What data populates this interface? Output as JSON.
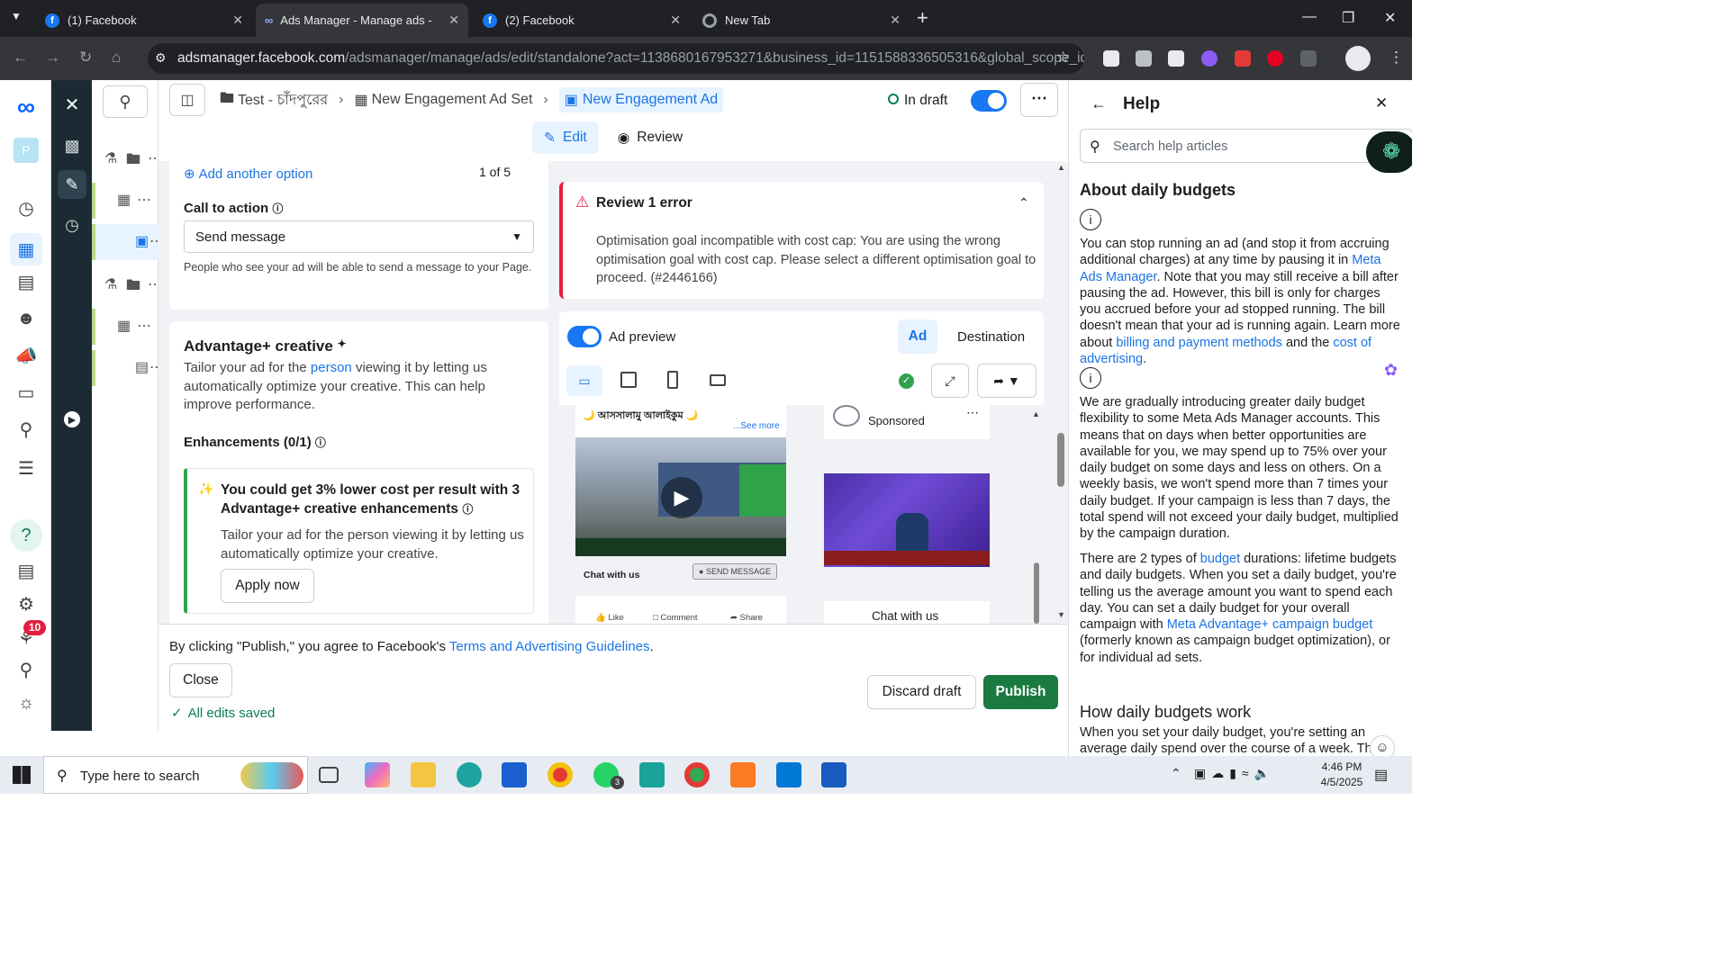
{
  "browser": {
    "tabs": [
      {
        "title": "(1) Facebook"
      },
      {
        "title": "Ads Manager - Manage ads - A"
      },
      {
        "title": "(2) Facebook"
      },
      {
        "title": "New Tab"
      }
    ],
    "url_host": "adsmanager.facebook.com",
    "url_path": "/adsmanager/manage/ads/edit/standalone?act=1138680167953271&business_id=1151588336505316&global_scope_id=11..."
  },
  "rail": {
    "avatar_letter": "P",
    "notification_count": "10"
  },
  "header": {
    "breadcrumb_campaign": "Test - চাঁদপুরের",
    "breadcrumb_adset": "New Engagement Ad Set",
    "breadcrumb_ad": "New Engagement Ad",
    "status": "In draft",
    "edit_tab": "Edit",
    "review_tab": "Review"
  },
  "editor": {
    "add_option": "Add another option",
    "option_counter": "1 of 5",
    "cta_label": "Call to action",
    "cta_value": "Send message",
    "cta_help": "People who see your ad will be able to send a message to your Page.",
    "advantage_title": "Advantage+ creative",
    "advantage_desc_pre": "Tailor your ad for the ",
    "advantage_desc_link": "person",
    "advantage_desc_post": " viewing it by letting us automatically optimize your creative. This can help improve performance.",
    "enhancements_label": "Enhancements (0/1)",
    "tip_title": "You could get 3% lower cost per result with 3 Advantage+ creative enhancements",
    "tip_desc": "Tailor your ad for the person viewing it by letting us automatically optimize your creative.",
    "apply_button": "Apply now"
  },
  "review": {
    "title": "Review 1 error",
    "message": "Optimisation goal incompatible with cost cap: You are using the wrong optimisation goal with cost cap. Please select a different optimisation goal to proceed. (#2446166)"
  },
  "preview": {
    "toggle_label": "Ad preview",
    "ad_tab": "Ad",
    "destination_tab": "Destination",
    "post_text": "আসসালামু আলাইকুম",
    "see_more": "...See more",
    "chat_label": "Chat with us",
    "send_message": "SEND MESSAGE",
    "like": "Like",
    "comment": "Comment",
    "share": "Share",
    "sponsored": "Sponsored",
    "chat_label_2": "Chat with us"
  },
  "footer": {
    "terms_pre": "By clicking \"Publish,\" you agree to Facebook's ",
    "terms_link": "Terms and Advertising Guidelines",
    "terms_post": ".",
    "close_button": "Close",
    "saved_status": "All edits saved",
    "discard_button": "Discard draft",
    "publish_button": "Publish"
  },
  "help": {
    "title": "Help",
    "search_placeholder": "Search help articles",
    "article_title": "About daily budgets",
    "p1_a": "You can stop running an ad (and stop it from accruing additional charges) at any time by pausing it in ",
    "p1_link": "Meta Ads Manager",
    "p1_b": ". Note that you may still receive a bill after pausing the ad. However, this bill is only for charges you accrued before your ad stopped running. The bill doesn't mean that your ad is running again. Learn more about ",
    "p1_link2": "billing and payment methods",
    "p1_c": " and the ",
    "p1_link3": "cost of advertising",
    "p1_d": ".",
    "p2": "We are gradually introducing greater daily budget flexibility to some Meta Ads Manager accounts. This means that on days when better opportunities are available for you, we may spend up to 75% over your daily budget on some days and less on others. On a weekly basis, we won't spend more than 7 times your daily budget. If your campaign is less than 7 days, the total spend will not exceed your daily budget, multiplied by the campaign duration.",
    "p3_a": "There are 2 types of ",
    "p3_link": "budget",
    "p3_b": " durations: lifetime budgets and daily budgets. When you set a daily budget, you're telling us the average amount you want to spend each day. You can set a daily budget for your overall campaign with ",
    "p3_link2": "Meta Advantage+ campaign budget",
    "p3_c": " (formerly known as campaign budget optimization), or for individual ad sets.",
    "h2": "How daily budgets work",
    "p4": "When you set your daily budget, you're setting an average daily spend over the course of a week. Th"
  },
  "taskbar": {
    "search_placeholder": "Type here to search",
    "time": "4:46 PM",
    "date": "4/5/2025",
    "whatsapp_badge": "3"
  }
}
